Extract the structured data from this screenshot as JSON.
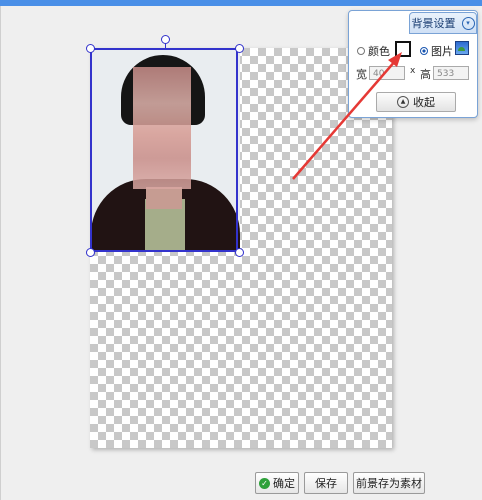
{
  "background_panel": {
    "tab_label": "背景设置",
    "color_option": "颜色",
    "image_option": "图片",
    "width_label": "宽",
    "height_label": "高",
    "times_sign": "x",
    "width_value": "40",
    "height_value": "533",
    "collapse_label": "收起",
    "selected_option": "image"
  },
  "footer": {
    "confirm_label": "确定",
    "save_label": "保存",
    "save_as_material_label": "前景存为素材"
  },
  "icons": [
    "chevron-down-icon",
    "image-icon",
    "collapse-icon",
    "checkmark-icon"
  ],
  "colors": {
    "accent_blue": "#3333cc",
    "annotation_red": "#e53935",
    "panel_border": "#7aa3d6"
  }
}
